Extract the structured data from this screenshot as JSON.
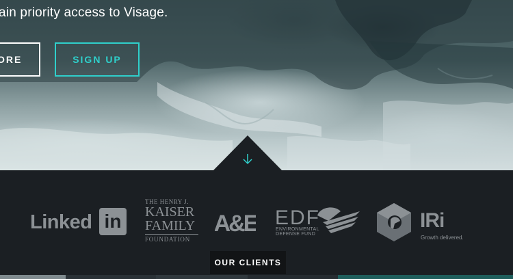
{
  "hero": {
    "tagline": "ain priority access to Visage.",
    "buttons": {
      "learn_more": "ORE",
      "sign_up": "SIGN UP"
    }
  },
  "clients": {
    "logos": {
      "linkedin": {
        "text": "Linked",
        "box": "in"
      },
      "kff": {
        "line1": "THE HENRY J.",
        "line2": "KAISER",
        "line3": "FAMILY",
        "line4": "FOUNDATION"
      },
      "ae": "A&E",
      "edf": {
        "main": "EDF",
        "sub1": "ENVIRONMENTAL",
        "sub2": "DEFENSE FUND"
      },
      "iri": {
        "main": "IRi",
        "tagline": "Growth delivered."
      }
    },
    "section_label": "OUR CLIENTS"
  },
  "colors": {
    "accent": "#2fd0cb",
    "background": "#1b1f23",
    "logo_gray": "#8c9195",
    "white": "#ffffff"
  },
  "icons": {
    "scroll_down": "arrow-down-icon"
  }
}
